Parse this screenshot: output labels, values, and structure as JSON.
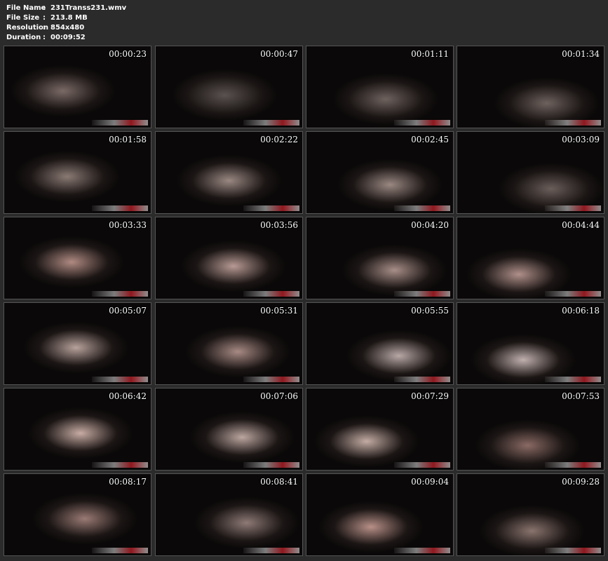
{
  "file_info": [
    {
      "label": "File Name",
      "sep": ":",
      "value": "231Transs231.wmv"
    },
    {
      "label": "File Size",
      "sep": ":",
      "value": "213.8 MB"
    },
    {
      "label": "Resolution",
      "sep": ":",
      "value": "854x480"
    },
    {
      "label": "Duration",
      "sep": ":",
      "value": "00:09:52"
    }
  ],
  "thumbnails": [
    {
      "time": "00:00:23",
      "tone": "#7a6a66"
    },
    {
      "time": "00:00:47",
      "tone": "#5a5250"
    },
    {
      "time": "00:01:11",
      "tone": "#6e625e"
    },
    {
      "time": "00:01:34",
      "tone": "#6e625e"
    },
    {
      "time": "00:01:58",
      "tone": "#8a7a74"
    },
    {
      "time": "00:02:22",
      "tone": "#9a8882"
    },
    {
      "time": "00:02:45",
      "tone": "#9a8882"
    },
    {
      "time": "00:03:09",
      "tone": "#6a5e5a"
    },
    {
      "time": "00:03:33",
      "tone": "#b08a82"
    },
    {
      "time": "00:03:56",
      "tone": "#b89a94"
    },
    {
      "time": "00:04:20",
      "tone": "#a88e88"
    },
    {
      "time": "00:04:44",
      "tone": "#b0908a"
    },
    {
      "time": "00:05:07",
      "tone": "#b8a29c"
    },
    {
      "time": "00:05:31",
      "tone": "#a88a84"
    },
    {
      "time": "00:05:55",
      "tone": "#b8a8a6"
    },
    {
      "time": "00:06:18",
      "tone": "#c0b0ae"
    },
    {
      "time": "00:06:42",
      "tone": "#c8aca4"
    },
    {
      "time": "00:07:06",
      "tone": "#bca6a0"
    },
    {
      "time": "00:07:29",
      "tone": "#c4aca4"
    },
    {
      "time": "00:07:53",
      "tone": "#8a6a64"
    },
    {
      "time": "00:08:17",
      "tone": "#9a7a74"
    },
    {
      "time": "00:08:41",
      "tone": "#8e7a76"
    },
    {
      "time": "00:09:04",
      "tone": "#b89088"
    },
    {
      "time": "00:09:28",
      "tone": "#8a746e"
    }
  ]
}
